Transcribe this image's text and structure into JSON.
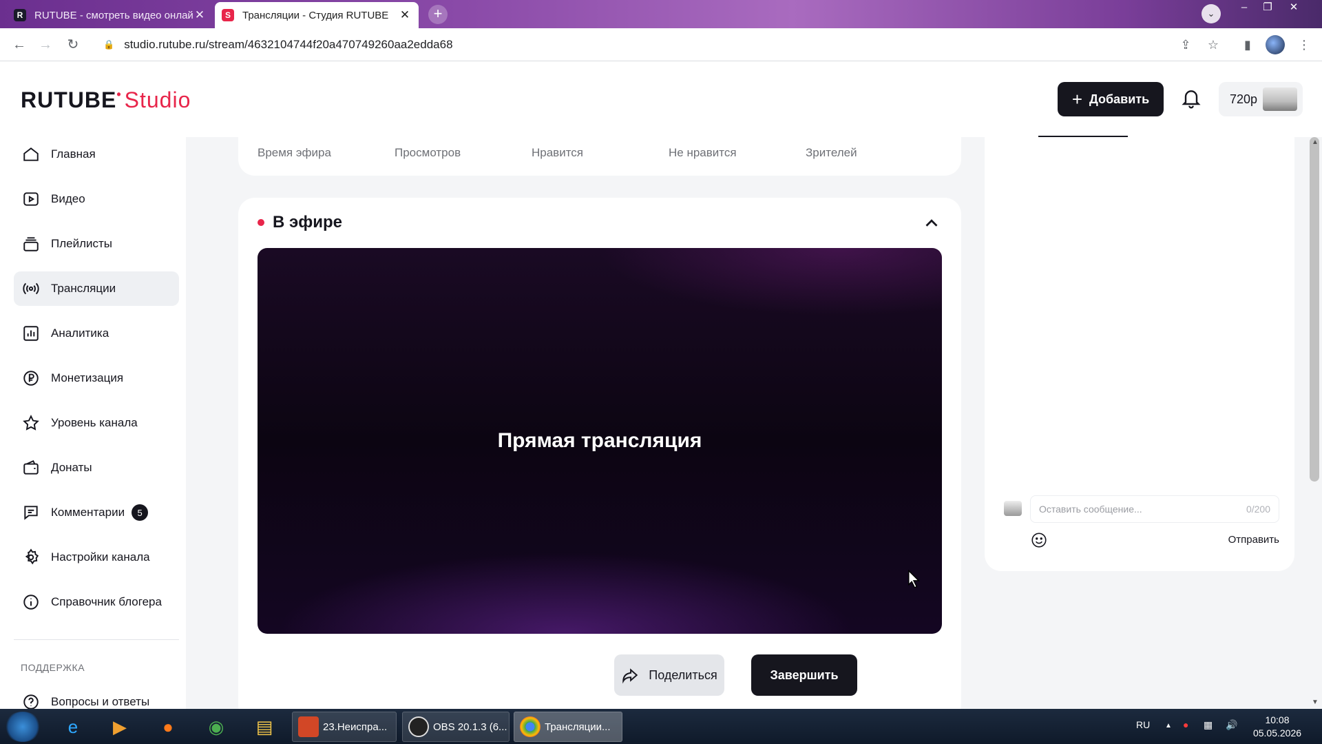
{
  "browser": {
    "tabs": [
      {
        "title": "RUTUBE - смотреть видео онлай",
        "favicon": "R"
      },
      {
        "title": "Трансляции - Студия RUTUBE",
        "favicon": "S"
      }
    ],
    "url": "studio.rutube.ru/stream/4632104744f20a470749260aa2edda68",
    "new_tab": "+"
  },
  "header": {
    "logo_main": "RUTUBE",
    "logo_accent": "Studio",
    "add_button": "Добавить",
    "quality": "720p"
  },
  "sidebar": {
    "items": [
      {
        "label": "Главная",
        "icon": "home-icon"
      },
      {
        "label": "Видео",
        "icon": "video-icon"
      },
      {
        "label": "Плейлисты",
        "icon": "playlists-icon"
      },
      {
        "label": "Трансляции",
        "icon": "broadcast-icon",
        "active": true
      },
      {
        "label": "Аналитика",
        "icon": "analytics-icon"
      },
      {
        "label": "Монетизация",
        "icon": "ruble-icon"
      },
      {
        "label": "Уровень канала",
        "icon": "star-icon"
      },
      {
        "label": "Донаты",
        "icon": "wallet-icon"
      },
      {
        "label": "Комментарии",
        "icon": "comments-icon",
        "badge": "5"
      },
      {
        "label": "Настройки канала",
        "icon": "gear-icon"
      },
      {
        "label": "Справочник блогера",
        "icon": "info-icon"
      }
    ],
    "support_label": "ПОДДЕРЖКА",
    "support_items": [
      {
        "label": "Вопросы и ответы",
        "icon": "help-icon"
      }
    ]
  },
  "stats": {
    "labels": [
      "Время эфира",
      "Просмотров",
      "Нравится",
      "Не нравится",
      "Зрителей"
    ]
  },
  "live": {
    "title": "В эфире",
    "player_text": "Прямая трансляция",
    "share_button": "Поделиться",
    "finish_button": "Завершить"
  },
  "chat": {
    "placeholder": "Оставить сообщение...",
    "counter": "0/200",
    "send_button": "Отправить"
  },
  "taskbar": {
    "tasks": [
      {
        "label": "23.Неиспра..."
      },
      {
        "label": "OBS 20.1.3 (6..."
      },
      {
        "label": "Трансляции..."
      }
    ],
    "lang": "RU",
    "time": "10:08",
    "date": "05.05.2026"
  },
  "colors": {
    "accent": "#e8254a",
    "dark": "#16161e",
    "page_bg": "#f4f5f7"
  }
}
